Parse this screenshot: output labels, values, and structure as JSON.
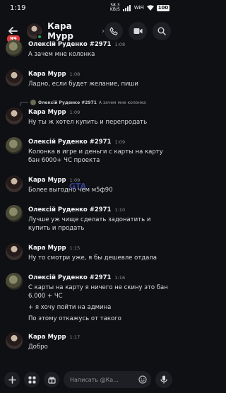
{
  "status_bar": {
    "time": "1:19",
    "speed": "58.3",
    "speed_unit": "KB/S",
    "battery": "100",
    "wifi": "WiFi"
  },
  "header": {
    "title": "Кара Мурр",
    "unread_count": "99"
  },
  "watermark": "GTA",
  "messages": [
    {
      "author": "Олексій Руденко #2971",
      "time": "1:08",
      "lines": [
        "А зачем мне колонка"
      ],
      "avatar": "o"
    },
    {
      "author": "Кара Мурр",
      "time": "1:08",
      "lines": [
        "Ладно, если будет желание, пиши"
      ],
      "avatar": "k"
    },
    {
      "reply_to": {
        "author": "Олексій Руденко #2971",
        "text": "А зачем мне колонка"
      },
      "author": "Кара Мурр",
      "time": "1:09",
      "lines": [
        "Ну ты ж хотел купить и перепродать"
      ],
      "avatar": "k"
    },
    {
      "author": "Олексій Руденко #2971",
      "time": "1:09",
      "lines": [
        "Колонка в игре и деньги с карты на карту",
        "бан 6000+ ЧС проекта"
      ],
      "avatar": "o"
    },
    {
      "author": "Кара Мурр",
      "time": "1:09",
      "lines": [
        "Более выгодно чем м5ф90"
      ],
      "avatar": "k"
    },
    {
      "author": "Олексій Руденко #2971",
      "time": "1:10",
      "lines": [
        "Лучше уж чище сделать задонатить и",
        "купить и продать"
      ],
      "avatar": "o"
    },
    {
      "author": "Кара Мурр",
      "time": "1:15",
      "lines": [
        "Ну то смотри уже, я бы дешевле отдала"
      ],
      "avatar": "k"
    },
    {
      "author": "Олексій Руденко #2971",
      "time": "1:16",
      "lines": [
        "С карты на карту я ничего не скину это бан",
        "6.000 + ЧС",
        "+ я хочу пойти на админа",
        "По этому откажусь от такого"
      ],
      "avatar": "o"
    },
    {
      "author": "Кара Мурр",
      "time": "1:17",
      "lines": [
        "Добро"
      ],
      "avatar": "k"
    }
  ],
  "composer": {
    "placeholder": "Написать @Ка..."
  },
  "icons": [
    "back-arrow-icon",
    "call-icon",
    "video-icon",
    "search-icon",
    "plus-icon",
    "apps-icon",
    "gift-icon",
    "emoji-icon",
    "microphone-icon"
  ],
  "colors": {
    "background": "#0f1014",
    "surface": "#1e1f24",
    "badge": "#e23b3b",
    "online": "#23a55a"
  }
}
